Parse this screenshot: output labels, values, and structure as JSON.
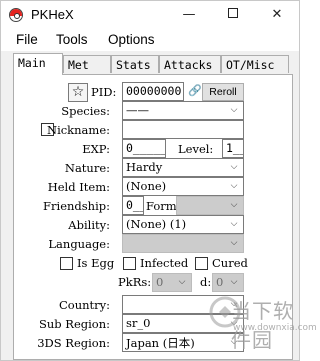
{
  "window": {
    "title": "PKHeX",
    "minimize": "—",
    "close": "✕"
  },
  "menu": [
    "File",
    "Tools",
    "Options"
  ],
  "tabs": [
    "Main",
    "Met",
    "Stats",
    "Attacks",
    "OT/Misc"
  ],
  "main": {
    "pid": {
      "label": "PID:",
      "value": "00000000",
      "reroll": "Reroll"
    },
    "species": {
      "label": "Species:",
      "value": "——"
    },
    "nickname": {
      "label": "Nickname:",
      "value": ""
    },
    "exp": {
      "label": "EXP:",
      "value": "0_____"
    },
    "level": {
      "label": "Level:",
      "value": "1__"
    },
    "nature": {
      "label": "Nature:",
      "value": "Hardy"
    },
    "held_item": {
      "label": "Held Item:",
      "value": "(None)"
    },
    "friendship": {
      "label": "Friendship:",
      "value": "0__"
    },
    "form": {
      "label": "Form:",
      "value": ""
    },
    "ability": {
      "label": "Ability:",
      "value": "(None) (1)"
    },
    "language": {
      "label": "Language:",
      "value": ""
    },
    "is_egg": {
      "label": "Is Egg"
    },
    "infected": {
      "label": "Infected"
    },
    "cured": {
      "label": "Cured"
    },
    "pkrs": {
      "label": "PkRs:",
      "value": "0",
      "d_label": "d:",
      "d_value": "0"
    },
    "country": {
      "label": "Country:",
      "value": ""
    },
    "sub_region": {
      "label": "Sub Region:",
      "value": "sr_0"
    },
    "region_3ds": {
      "label": "3DS Region:",
      "value": "Japan (日本)"
    }
  },
  "watermark": {
    "text": "当下软件园",
    "url": "www.downxia.com"
  },
  "colors": {
    "pokeball_red": "#e52521",
    "disabled": "#cccccc"
  }
}
